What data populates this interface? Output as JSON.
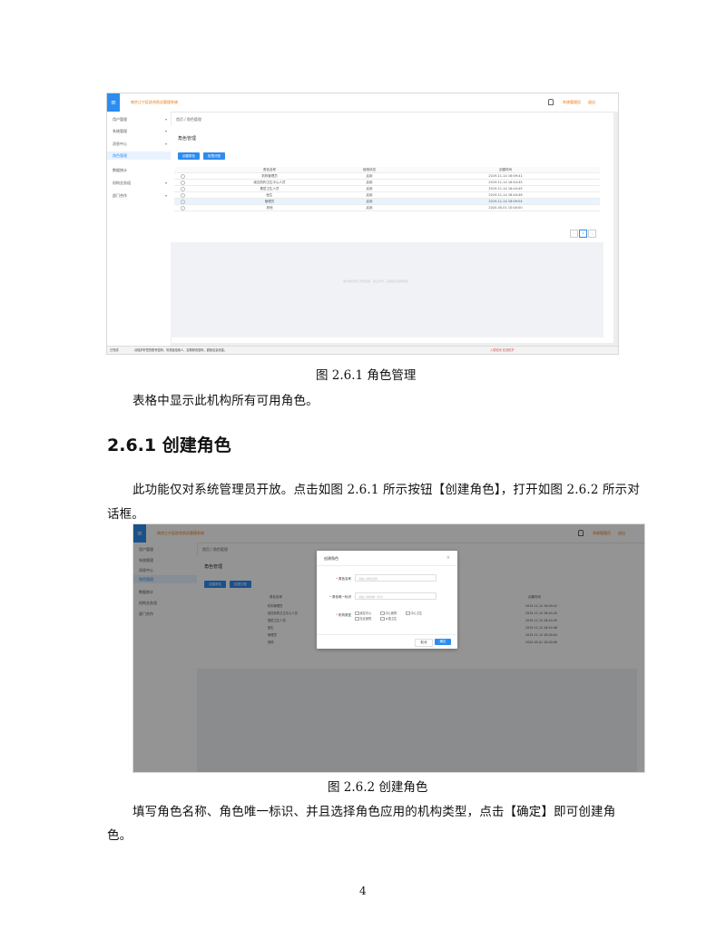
{
  "screenshot1": {
    "app_title": "南京江宁区综合防治管理系统",
    "user_label": "系统管理员",
    "logout_label": "退出",
    "menu_icon": "menu-icon",
    "sidebar_items": [
      {
        "label": "用户管理",
        "arrow": "▾"
      },
      {
        "label": "系统管理",
        "arrow": "▾"
      },
      {
        "label": "消息中心",
        "arrow": "▾"
      },
      {
        "label": "角色管理",
        "arrow": ""
      },
      {
        "label": "数据统计",
        "arrow": ""
      },
      {
        "label": "机构业务组",
        "arrow": "▾"
      },
      {
        "label": "部门合作",
        "arrow": "▾"
      }
    ],
    "breadcrumb": "首页 / 角色管理",
    "card_title": "角色管理",
    "create_button": "创建角色",
    "assign_button": "权限分配",
    "table_headers": [
      "角色名称",
      "使用状态",
      "创建时间"
    ],
    "table_rows": [
      [
        "机构管理员",
        "启用",
        "2019-11-14 16:09:41"
      ],
      [
        "疾控机构卫生中心人员",
        "启用",
        "2019-11-14 16:44:45"
      ],
      [
        "基层卫生人员",
        "启用",
        "2019-11-14 16:44:45"
      ],
      [
        "医生",
        "启用",
        "2019-11-14 16:44:46"
      ],
      [
        "管理员",
        "启用",
        "2019-11-14 18:09:04"
      ],
      [
        "其他",
        "启用",
        "2020-05-01 10:00:00"
      ]
    ],
    "pager": {
      "prev": "‹",
      "current": "1",
      "next": "›"
    },
    "watermark": "本系统仅供江宁区使用，禁止外传，违者追究法律责任",
    "status_left": "已完成",
    "status_msg": "请保护好您的账号密码，勿泄露给他人，定期修改密码，避免信息泄露。",
    "status_right": "入侵检测  在线防护"
  },
  "caption1": "图 2.6.1  角色管理",
  "para1": "表格中显示此机构所有可用角色。",
  "heading": "2.6.1  创建角色",
  "para2_line1": "此功能仅对系统管理员开放。点击如图 2.6.1 所示按钮【创建角色】，打开如图 2.6.2 所示对",
  "para2_line2": "话框。",
  "screenshot2": {
    "app_title": "南京江宁区综合防治管理系统",
    "user_label": "系统管理员",
    "logout_label": "退出",
    "sidebar_items": [
      "用户管理",
      "系统管理",
      "消息中心",
      "角色管理",
      "数据统计",
      "机构业务组",
      "部门合作"
    ],
    "breadcrumb": "首页 / 角色管理",
    "card_title": "角色管理",
    "create_button": "创建角色",
    "assign_button": "权限分配",
    "header_name": "角色名称",
    "header_time": "创建时间",
    "rows_name": [
      "机构管理员",
      "疾控机构卫生中心人员",
      "基层卫生人员",
      "医生",
      "管理员",
      "其他"
    ],
    "rows_time": [
      "2019-11-14 16:09:41",
      "2019-11-14 16:44:45",
      "2019-11-14 16:44:45",
      "2019-11-14 16:44:46",
      "2019-11-14 18:09:04",
      "2020-05-01 10:00:00"
    ],
    "modal": {
      "title": "创建角色",
      "close": "×",
      "label_name": "角色名称",
      "placeholder_name": "请输入角色名称",
      "label_id": "角色唯一标识",
      "placeholder_id": "请输入角色唯一标识",
      "label_type": "机构类型",
      "options": [
        "疾控中心",
        "中心医院",
        "中心卫生",
        "社区医院",
        "乡镇卫生"
      ],
      "cancel": "取消",
      "confirm": "确定"
    }
  },
  "caption2": "图 2.6.2  创建角色",
  "para3_line1": "填写角色名称、角色唯一标识、并且选择角色应用的机构类型，点击【确定】即可创建角",
  "para3_line2": "色。",
  "page_number": "4",
  "colors": {
    "primary": "#2d8cf0",
    "accent": "#e8710a"
  }
}
